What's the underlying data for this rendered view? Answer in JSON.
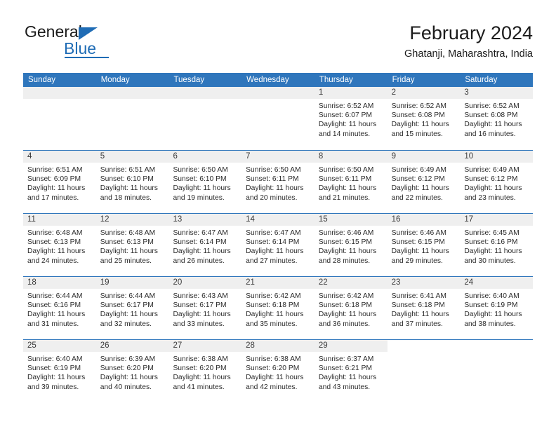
{
  "logo": {
    "word_one": "General",
    "word_two": "Blue",
    "triangle_color": "#1f6cb5"
  },
  "header": {
    "title": "February 2024",
    "location": "Ghatanji, Maharashtra, India"
  },
  "theme": {
    "header_blue": "#2f76bc",
    "date_strip_gray": "#efefef",
    "text_dark": "#1b1b1b"
  },
  "weekdays": [
    "Sunday",
    "Monday",
    "Tuesday",
    "Wednesday",
    "Thursday",
    "Friday",
    "Saturday"
  ],
  "weeks": [
    [
      {
        "day": "",
        "state": "blank"
      },
      {
        "day": "",
        "state": "blank"
      },
      {
        "day": "",
        "state": "blank"
      },
      {
        "day": "",
        "state": "blank"
      },
      {
        "day": "1",
        "state": "day",
        "sunrise": "Sunrise: 6:52 AM",
        "sunset": "Sunset: 6:07 PM",
        "daylight_line1": "Daylight: 11 hours",
        "daylight_line2": "and 14 minutes."
      },
      {
        "day": "2",
        "state": "day",
        "sunrise": "Sunrise: 6:52 AM",
        "sunset": "Sunset: 6:08 PM",
        "daylight_line1": "Daylight: 11 hours",
        "daylight_line2": "and 15 minutes."
      },
      {
        "day": "3",
        "state": "day",
        "sunrise": "Sunrise: 6:52 AM",
        "sunset": "Sunset: 6:08 PM",
        "daylight_line1": "Daylight: 11 hours",
        "daylight_line2": "and 16 minutes."
      }
    ],
    [
      {
        "day": "4",
        "state": "day",
        "sunrise": "Sunrise: 6:51 AM",
        "sunset": "Sunset: 6:09 PM",
        "daylight_line1": "Daylight: 11 hours",
        "daylight_line2": "and 17 minutes."
      },
      {
        "day": "5",
        "state": "day",
        "sunrise": "Sunrise: 6:51 AM",
        "sunset": "Sunset: 6:10 PM",
        "daylight_line1": "Daylight: 11 hours",
        "daylight_line2": "and 18 minutes."
      },
      {
        "day": "6",
        "state": "day",
        "sunrise": "Sunrise: 6:50 AM",
        "sunset": "Sunset: 6:10 PM",
        "daylight_line1": "Daylight: 11 hours",
        "daylight_line2": "and 19 minutes."
      },
      {
        "day": "7",
        "state": "day",
        "sunrise": "Sunrise: 6:50 AM",
        "sunset": "Sunset: 6:11 PM",
        "daylight_line1": "Daylight: 11 hours",
        "daylight_line2": "and 20 minutes."
      },
      {
        "day": "8",
        "state": "day",
        "sunrise": "Sunrise: 6:50 AM",
        "sunset": "Sunset: 6:11 PM",
        "daylight_line1": "Daylight: 11 hours",
        "daylight_line2": "and 21 minutes."
      },
      {
        "day": "9",
        "state": "day",
        "sunrise": "Sunrise: 6:49 AM",
        "sunset": "Sunset: 6:12 PM",
        "daylight_line1": "Daylight: 11 hours",
        "daylight_line2": "and 22 minutes."
      },
      {
        "day": "10",
        "state": "day",
        "sunrise": "Sunrise: 6:49 AM",
        "sunset": "Sunset: 6:12 PM",
        "daylight_line1": "Daylight: 11 hours",
        "daylight_line2": "and 23 minutes."
      }
    ],
    [
      {
        "day": "11",
        "state": "day",
        "sunrise": "Sunrise: 6:48 AM",
        "sunset": "Sunset: 6:13 PM",
        "daylight_line1": "Daylight: 11 hours",
        "daylight_line2": "and 24 minutes."
      },
      {
        "day": "12",
        "state": "day",
        "sunrise": "Sunrise: 6:48 AM",
        "sunset": "Sunset: 6:13 PM",
        "daylight_line1": "Daylight: 11 hours",
        "daylight_line2": "and 25 minutes."
      },
      {
        "day": "13",
        "state": "day",
        "sunrise": "Sunrise: 6:47 AM",
        "sunset": "Sunset: 6:14 PM",
        "daylight_line1": "Daylight: 11 hours",
        "daylight_line2": "and 26 minutes."
      },
      {
        "day": "14",
        "state": "day",
        "sunrise": "Sunrise: 6:47 AM",
        "sunset": "Sunset: 6:14 PM",
        "daylight_line1": "Daylight: 11 hours",
        "daylight_line2": "and 27 minutes."
      },
      {
        "day": "15",
        "state": "day",
        "sunrise": "Sunrise: 6:46 AM",
        "sunset": "Sunset: 6:15 PM",
        "daylight_line1": "Daylight: 11 hours",
        "daylight_line2": "and 28 minutes."
      },
      {
        "day": "16",
        "state": "day",
        "sunrise": "Sunrise: 6:46 AM",
        "sunset": "Sunset: 6:15 PM",
        "daylight_line1": "Daylight: 11 hours",
        "daylight_line2": "and 29 minutes."
      },
      {
        "day": "17",
        "state": "day",
        "sunrise": "Sunrise: 6:45 AM",
        "sunset": "Sunset: 6:16 PM",
        "daylight_line1": "Daylight: 11 hours",
        "daylight_line2": "and 30 minutes."
      }
    ],
    [
      {
        "day": "18",
        "state": "day",
        "sunrise": "Sunrise: 6:44 AM",
        "sunset": "Sunset: 6:16 PM",
        "daylight_line1": "Daylight: 11 hours",
        "daylight_line2": "and 31 minutes."
      },
      {
        "day": "19",
        "state": "day",
        "sunrise": "Sunrise: 6:44 AM",
        "sunset": "Sunset: 6:17 PM",
        "daylight_line1": "Daylight: 11 hours",
        "daylight_line2": "and 32 minutes."
      },
      {
        "day": "20",
        "state": "day",
        "sunrise": "Sunrise: 6:43 AM",
        "sunset": "Sunset: 6:17 PM",
        "daylight_line1": "Daylight: 11 hours",
        "daylight_line2": "and 33 minutes."
      },
      {
        "day": "21",
        "state": "day",
        "sunrise": "Sunrise: 6:42 AM",
        "sunset": "Sunset: 6:18 PM",
        "daylight_line1": "Daylight: 11 hours",
        "daylight_line2": "and 35 minutes."
      },
      {
        "day": "22",
        "state": "day",
        "sunrise": "Sunrise: 6:42 AM",
        "sunset": "Sunset: 6:18 PM",
        "daylight_line1": "Daylight: 11 hours",
        "daylight_line2": "and 36 minutes."
      },
      {
        "day": "23",
        "state": "day",
        "sunrise": "Sunrise: 6:41 AM",
        "sunset": "Sunset: 6:18 PM",
        "daylight_line1": "Daylight: 11 hours",
        "daylight_line2": "and 37 minutes."
      },
      {
        "day": "24",
        "state": "day",
        "sunrise": "Sunrise: 6:40 AM",
        "sunset": "Sunset: 6:19 PM",
        "daylight_line1": "Daylight: 11 hours",
        "daylight_line2": "and 38 minutes."
      }
    ],
    [
      {
        "day": "25",
        "state": "day",
        "sunrise": "Sunrise: 6:40 AM",
        "sunset": "Sunset: 6:19 PM",
        "daylight_line1": "Daylight: 11 hours",
        "daylight_line2": "and 39 minutes."
      },
      {
        "day": "26",
        "state": "day",
        "sunrise": "Sunrise: 6:39 AM",
        "sunset": "Sunset: 6:20 PM",
        "daylight_line1": "Daylight: 11 hours",
        "daylight_line2": "and 40 minutes."
      },
      {
        "day": "27",
        "state": "day",
        "sunrise": "Sunrise: 6:38 AM",
        "sunset": "Sunset: 6:20 PM",
        "daylight_line1": "Daylight: 11 hours",
        "daylight_line2": "and 41 minutes."
      },
      {
        "day": "28",
        "state": "day",
        "sunrise": "Sunrise: 6:38 AM",
        "sunset": "Sunset: 6:20 PM",
        "daylight_line1": "Daylight: 11 hours",
        "daylight_line2": "and 42 minutes."
      },
      {
        "day": "29",
        "state": "day",
        "sunrise": "Sunrise: 6:37 AM",
        "sunset": "Sunset: 6:21 PM",
        "daylight_line1": "Daylight: 11 hours",
        "daylight_line2": "and 43 minutes."
      },
      {
        "day": "",
        "state": "void"
      },
      {
        "day": "",
        "state": "void"
      }
    ]
  ]
}
